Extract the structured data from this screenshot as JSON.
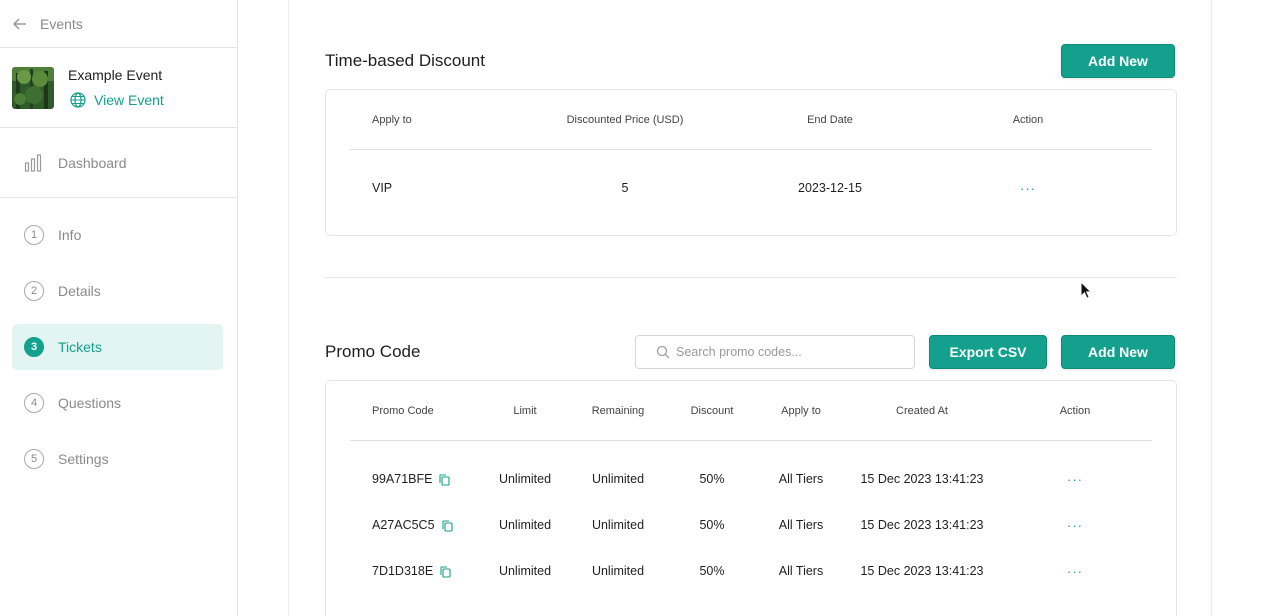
{
  "sidebar": {
    "back_label": "Events",
    "event_name": "Example Event",
    "view_event_label": "View Event",
    "dashboard_label": "Dashboard",
    "steps": [
      {
        "num": "1",
        "label": "Info"
      },
      {
        "num": "2",
        "label": "Details"
      },
      {
        "num": "3",
        "label": "Tickets"
      },
      {
        "num": "4",
        "label": "Questions"
      },
      {
        "num": "5",
        "label": "Settings"
      }
    ],
    "active_step": "Tickets"
  },
  "time_discount": {
    "title": "Time-based Discount",
    "add_label": "Add New",
    "columns": [
      "Apply to",
      "Discounted Price (USD)",
      "End Date",
      "Action"
    ],
    "rows": [
      {
        "apply_to": "VIP",
        "price": "5",
        "end_date": "2023-12-15",
        "action": "···"
      }
    ]
  },
  "promo": {
    "title": "Promo Code",
    "search_placeholder": "Search promo codes...",
    "export_label": "Export CSV",
    "add_label": "Add New",
    "columns": [
      "Promo Code",
      "Limit",
      "Remaining",
      "Discount",
      "Apply to",
      "Created At",
      "Action"
    ],
    "rows": [
      {
        "code": "99A71BFE",
        "limit": "Unlimited",
        "remaining": "Unlimited",
        "discount": "50%",
        "apply_to": "All Tiers",
        "created": "15 Dec 2023 13:41:23",
        "action": "···"
      },
      {
        "code": "A27AC5C5",
        "limit": "Unlimited",
        "remaining": "Unlimited",
        "discount": "50%",
        "apply_to": "All Tiers",
        "created": "15 Dec 2023 13:41:23",
        "action": "···"
      },
      {
        "code": "7D1D318E",
        "limit": "Unlimited",
        "remaining": "Unlimited",
        "discount": "50%",
        "apply_to": "All Tiers",
        "created": "15 Dec 2023 13:41:23",
        "action": "···"
      }
    ]
  },
  "colors": {
    "accent": "#13a08d",
    "accent_light": "#e3f5f2"
  }
}
